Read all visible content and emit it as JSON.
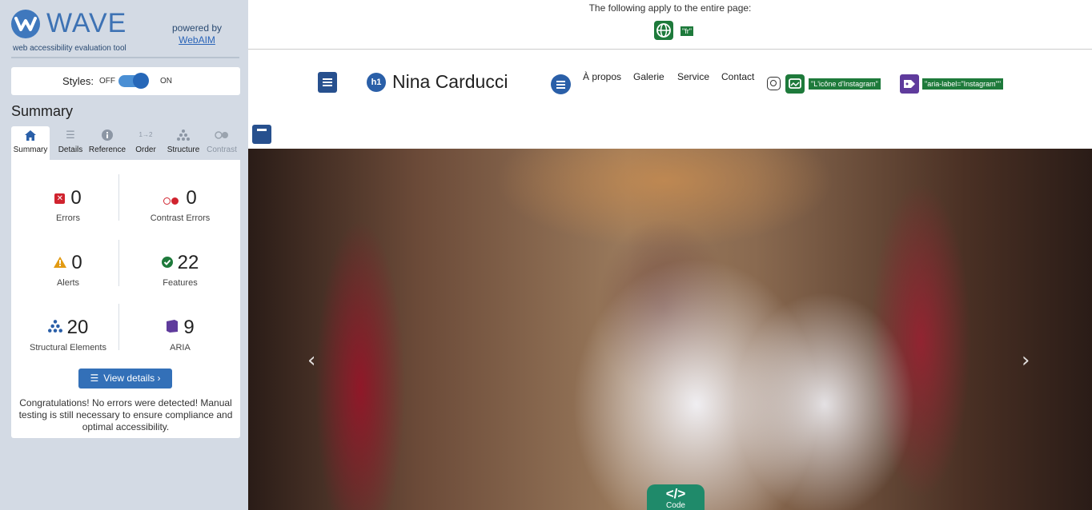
{
  "wave": {
    "wordmark": "WAVE",
    "tagline": "web accessibility evaluation tool",
    "powered_by": "powered by",
    "powered_link": "WebAIM",
    "styles_label": "Styles:",
    "styles_off": "OFF",
    "styles_on": "ON",
    "summary_heading": "Summary",
    "tabs": [
      {
        "label": "Summary",
        "icon": "home-icon"
      },
      {
        "label": "Details",
        "icon": "list-icon"
      },
      {
        "label": "Reference",
        "icon": "info-icon"
      },
      {
        "label": "Order",
        "icon": "order-icon"
      },
      {
        "label": "Structure",
        "icon": "structure-icon"
      },
      {
        "label": "Contrast",
        "icon": "contrast-icon"
      }
    ],
    "stats": {
      "errors": {
        "value": "0",
        "label": "Errors"
      },
      "contrast_errors": {
        "value": "0",
        "label": "Contrast Errors"
      },
      "alerts": {
        "value": "0",
        "label": "Alerts"
      },
      "features": {
        "value": "22",
        "label": "Features"
      },
      "structural": {
        "value": "20",
        "label": "Structural Elements"
      },
      "aria": {
        "value": "9",
        "label": "ARIA"
      }
    },
    "view_details": "View details ›",
    "congrats": "Congratulations! No errors were detected! Manual testing is still necessary to ensure compliance and optimal accessibility."
  },
  "page": {
    "notice": "The following apply to the entire page:",
    "lang_tag": "\"fr\"",
    "site_title": "Nina Carducci",
    "h1_badge": "h1",
    "nav": [
      "À propos",
      "Galerie",
      "Service",
      "Contact"
    ],
    "instagram_alt_tag": "\"L'icône d'Instagram\"",
    "aria_label_tag": "\"aria-label=\"Instagram\"\"",
    "carousel_prev": "‹",
    "carousel_next": "›",
    "code_button_symbol": "</>",
    "code_button_label": "Code"
  },
  "colors": {
    "wave_blue": "#3d72b4",
    "sidebar_bg": "#d3dae4",
    "error_red": "#d0232e",
    "feature_green": "#1e7a3b",
    "aria_purple": "#5f3b9c",
    "code_teal": "#1f8a6a"
  }
}
